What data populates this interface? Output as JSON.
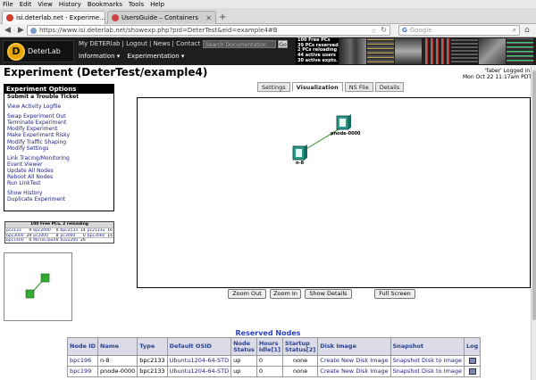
{
  "browser": {
    "menu": [
      "File",
      "Edit",
      "View",
      "History",
      "Bookmarks",
      "Tools",
      "Help"
    ],
    "tabs": [
      {
        "title": "isi.deterlab.net - Experime...",
        "favicon_color": "#d23a2a",
        "active": true
      },
      {
        "title": "UsersGuide – Containers",
        "favicon_color": "#cc4444",
        "active": false
      }
    ],
    "url": "https://www.isi.deterlab.net/showexp.php?pid=DeterTest&eid=example4#B",
    "search_placeholder": "Google"
  },
  "header": {
    "logo_letter": "D",
    "logo_text": "DeterLab",
    "top_links": [
      "My DETERlab",
      "Logout",
      "News",
      "Contact Us"
    ],
    "search_placeholder": "Search Documentation",
    "go_label": "Go",
    "menus": [
      "Information ▾",
      "Experimentation ▾"
    ],
    "stats": [
      "100 Free PCs",
      "39 PCs reserved",
      "2 PCs reloading",
      "44 active users",
      "30 active expts."
    ]
  },
  "page": {
    "title": "Experiment (DeterTest/example4)",
    "logged_in_line1": "'faber' Logged in.",
    "logged_in_line2": "Mon Oct 22 11:17am PDT"
  },
  "tabs": [
    "Settings",
    "Visualization",
    "NS File",
    "Details"
  ],
  "active_tab": "Visualization",
  "sidebar": {
    "title": "Experiment Options",
    "groups": [
      [
        {
          "label": "Submit a Trouble Ticket",
          "bold": true
        }
      ],
      [
        {
          "label": "View Activity Logfile"
        }
      ],
      [
        {
          "label": "Swap Experiment Out"
        },
        {
          "label": "Terminate Experiment"
        },
        {
          "label": "Modify Experiment"
        },
        {
          "label": "Make Experiment Risky"
        },
        {
          "label": "Modify Traffic Shaping"
        },
        {
          "label": "Modify Settings"
        }
      ],
      [
        {
          "label": "Link Tracing/Monitoring"
        },
        {
          "label": "Event Viewer"
        },
        {
          "label": "Update All Nodes"
        },
        {
          "label": "Reboot All Nodes"
        },
        {
          "label": "Run LinkTest"
        }
      ],
      [
        {
          "label": "Show History"
        },
        {
          "label": "Duplicate Experiment"
        }
      ]
    ]
  },
  "freepcs": {
    "title": "100 Free PCs, 2 reloading",
    "rows": [
      [
        "pc2133",
        "9",
        "bpc2000",
        "0",
        "bpc2133",
        "14",
        "pc2133u",
        "16"
      ],
      [
        "bpc3000",
        "29",
        "pc2000",
        "8",
        "pc3000",
        "0",
        "bpc3060",
        "14"
      ],
      [
        "bpc1400",
        "0",
        "MicroCloud",
        "0",
        "bvx2200",
        "26",
        "",
        ""
      ]
    ]
  },
  "visualization": {
    "nodes": [
      {
        "name": "pnode-0000"
      },
      {
        "name": "n-8"
      }
    ],
    "buttons": {
      "zoom_out": "Zoom Out",
      "zoom_in": "Zoom In",
      "show_details": "Show Details",
      "full_screen": "Full Screen"
    }
  },
  "reserved": {
    "title": "Reserved Nodes",
    "columns": [
      "Node ID",
      "Name",
      "Type",
      "Default OSID",
      "Node Status",
      "Hours Idle[1]",
      "Startup Status[2]",
      "Disk Image",
      "Snapshot",
      "Log"
    ],
    "rows": [
      {
        "node_id": "bpc196",
        "name": "n-8",
        "type": "bpc2133",
        "osid": "Ubuntu1204-64-STD",
        "status": "up",
        "idle": "0",
        "startup": "none",
        "disk": "Create New Disk Image",
        "snapshot": "Snapshot Disk to Image"
      },
      {
        "node_id": "bpc199",
        "name": "pnode-0000",
        "type": "bpc2133",
        "osid": "Ubuntu1204-64-STD",
        "status": "up",
        "idle": "0",
        "startup": "none",
        "disk": "Create New Disk Image",
        "snapshot": "Snapshot Disk to Image"
      }
    ]
  }
}
